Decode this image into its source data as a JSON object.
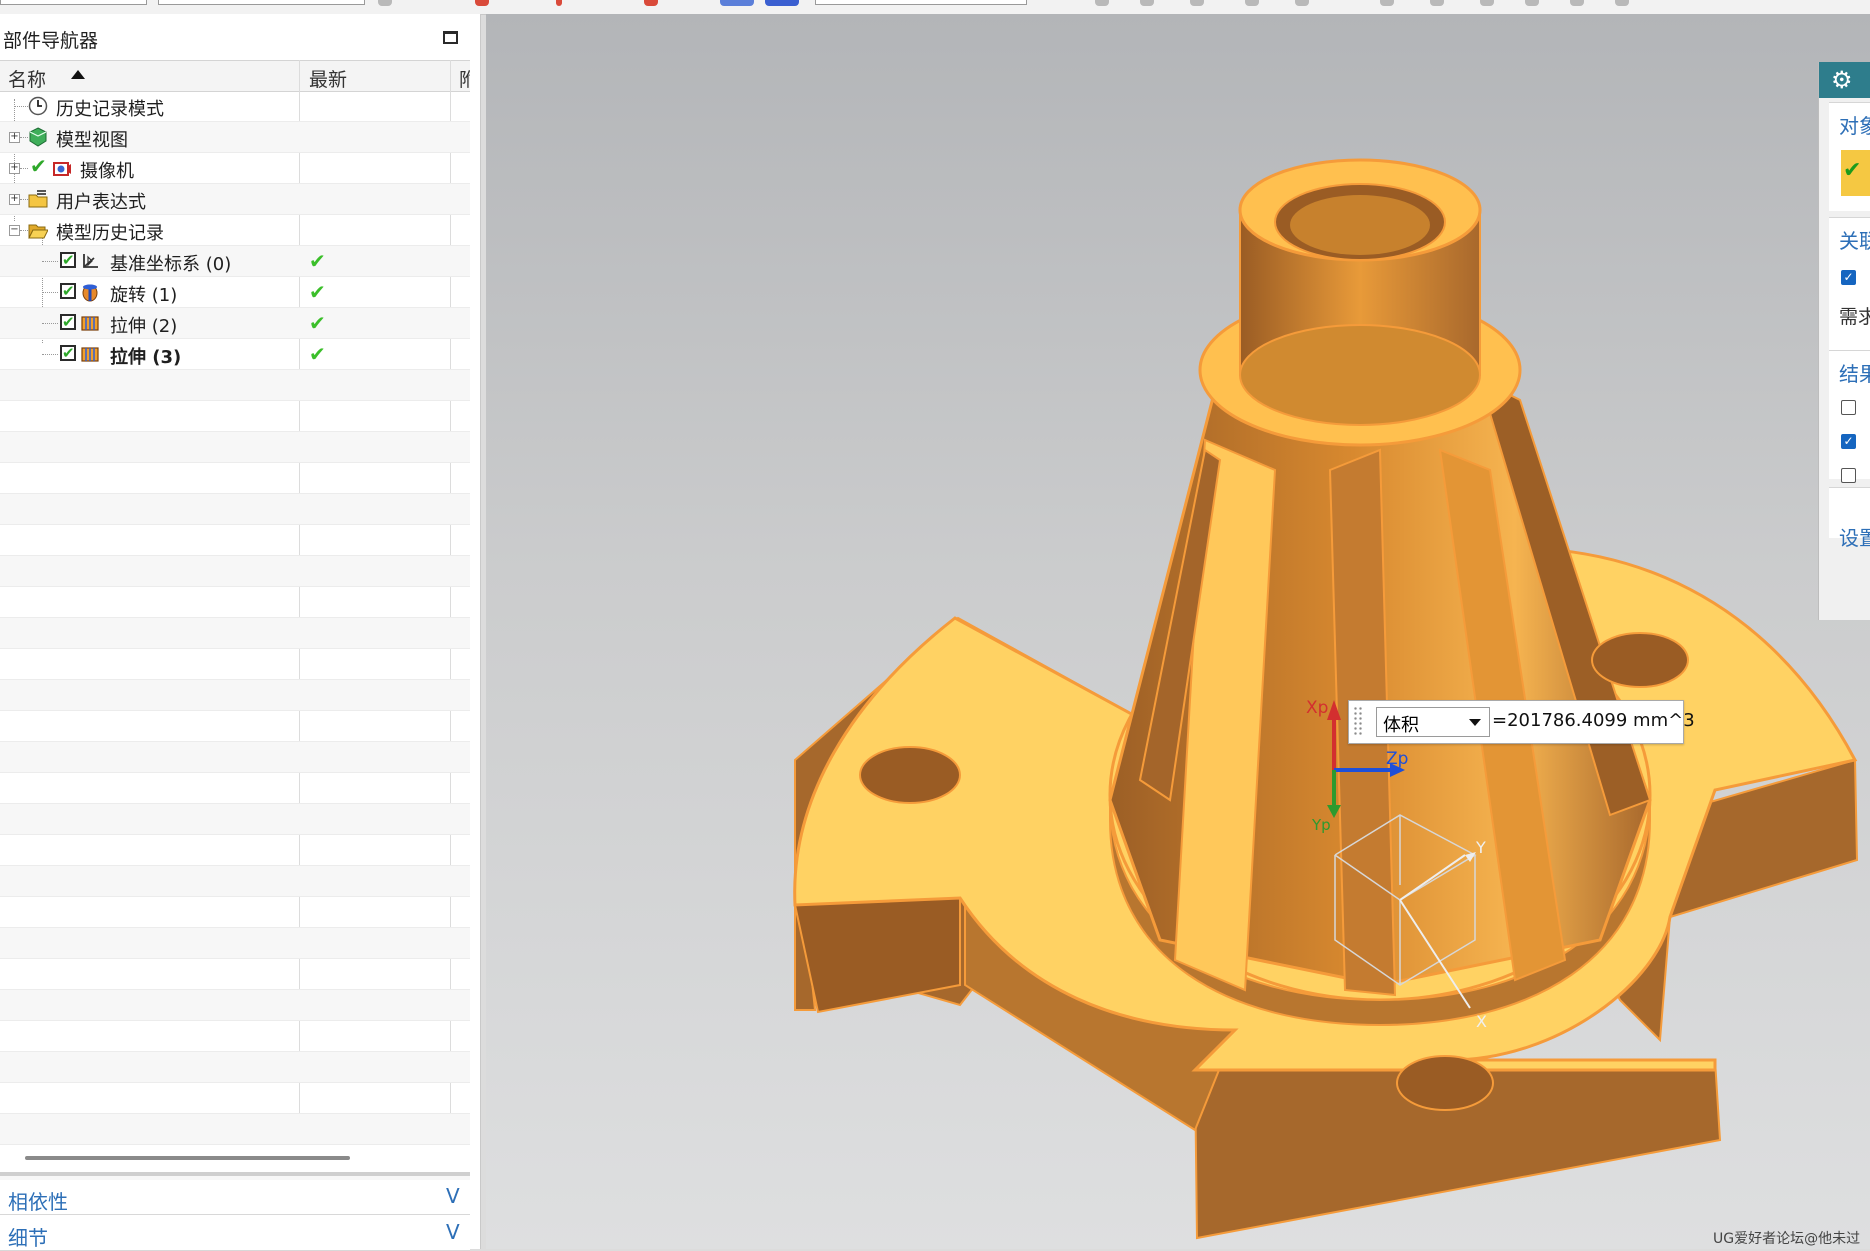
{
  "navigator": {
    "title": "部件导航器",
    "columns": {
      "name": "名称",
      "latest": "最新",
      "extra": "附"
    },
    "nodes": [
      {
        "label": "历史记录模式",
        "icon": "clock-icon"
      },
      {
        "label": "模型视图",
        "icon": "model-views-icon",
        "expander": "+"
      },
      {
        "label": "摄像机",
        "icon": "camera-icon",
        "expander": "+"
      },
      {
        "label": "用户表达式",
        "icon": "folder-icon",
        "expander": "+"
      },
      {
        "label": "模型历史记录",
        "icon": "folder-open-icon",
        "expander": "−"
      }
    ],
    "features": [
      {
        "label": "基准坐标系 (0)",
        "icon": "datum-csys-icon",
        "latest": "✔"
      },
      {
        "label": "旋转 (1)",
        "icon": "revolve-icon",
        "latest": "✔"
      },
      {
        "label": "拉伸 (2)",
        "icon": "extrude-icon",
        "latest": "✔"
      },
      {
        "label": "拉伸 (3)",
        "icon": "extrude-icon",
        "latest": "✔",
        "current": true
      }
    ],
    "panels": {
      "dependencies": "相依性",
      "details": "细节"
    }
  },
  "measure": {
    "type": "体积",
    "value": "=201786.4099 mm^3"
  },
  "triad": {
    "x": "Xp",
    "y": "Yp",
    "z": "Zp"
  },
  "wcs": {
    "x": "X",
    "y": "Y"
  },
  "dialog": {
    "sections": [
      "对象",
      "关联",
      "结果",
      "设置"
    ],
    "text_need": "需求"
  },
  "colors": {
    "part_fill": "#f7b24d",
    "part_top": "#ffd263",
    "part_dark": "#a6682c",
    "accent_blue": "#2d6fb7",
    "check_green": "#3bbf2a"
  },
  "watermark": "UG爱好者论坛@他未过"
}
